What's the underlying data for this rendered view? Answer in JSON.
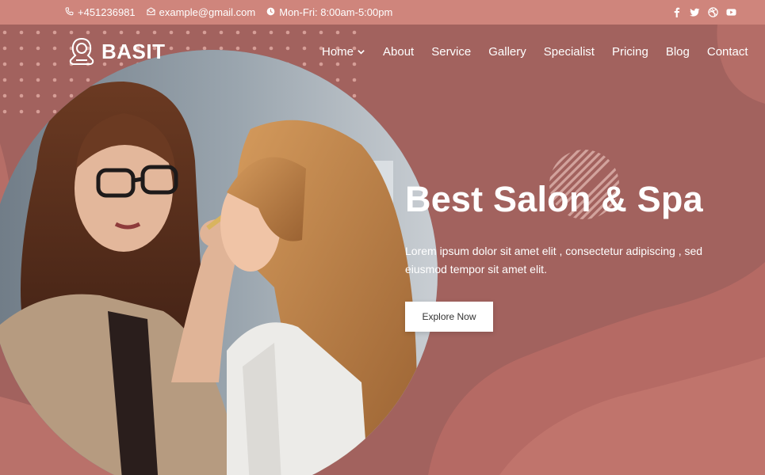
{
  "topbar": {
    "phone": "+451236981",
    "email": "example@gmail.com",
    "hours": "Mon-Fri: 8:00am-5:00pm",
    "social": [
      "facebook-icon",
      "twitter-icon",
      "dribbble-icon",
      "youtube-icon"
    ]
  },
  "brand": {
    "name": "BASIT"
  },
  "nav": {
    "items": [
      "Home",
      "About",
      "Service",
      "Gallery",
      "Specialist",
      "Pricing",
      "Blog",
      "Contact"
    ]
  },
  "hero": {
    "title": "Best Salon & Spa",
    "description": "Lorem ipsum dolor sit amet elit , consectetur adipiscing , sed eiusmod tempor sit amet elit.",
    "cta_label": "Explore Now"
  },
  "colors": {
    "topbar": "#cf857c",
    "hero_bg": "#a2625e",
    "accent": "#c5736b"
  }
}
